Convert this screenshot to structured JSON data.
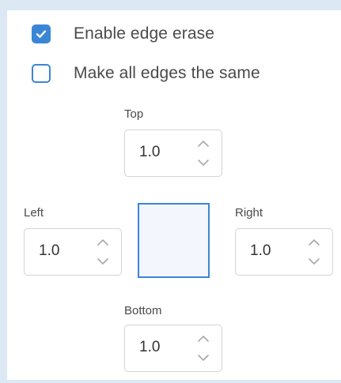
{
  "options": {
    "enable_edge_erase": {
      "label": "Enable edge erase",
      "checked": true
    },
    "same_edges": {
      "label": "Make all edges the same",
      "checked": false
    }
  },
  "edges": {
    "top": {
      "label": "Top",
      "value": "1.0"
    },
    "left": {
      "label": "Left",
      "value": "1.0"
    },
    "right": {
      "label": "Right",
      "value": "1.0"
    },
    "bottom": {
      "label": "Bottom",
      "value": "1.0"
    }
  },
  "icons": {
    "check": "checkmark-icon",
    "increment": "chevron-up-icon",
    "decrement": "chevron-down-icon"
  },
  "colors": {
    "accent": "#3a86d6",
    "frame": "#dce9f5",
    "preview_fill": "#f3f6fd"
  }
}
